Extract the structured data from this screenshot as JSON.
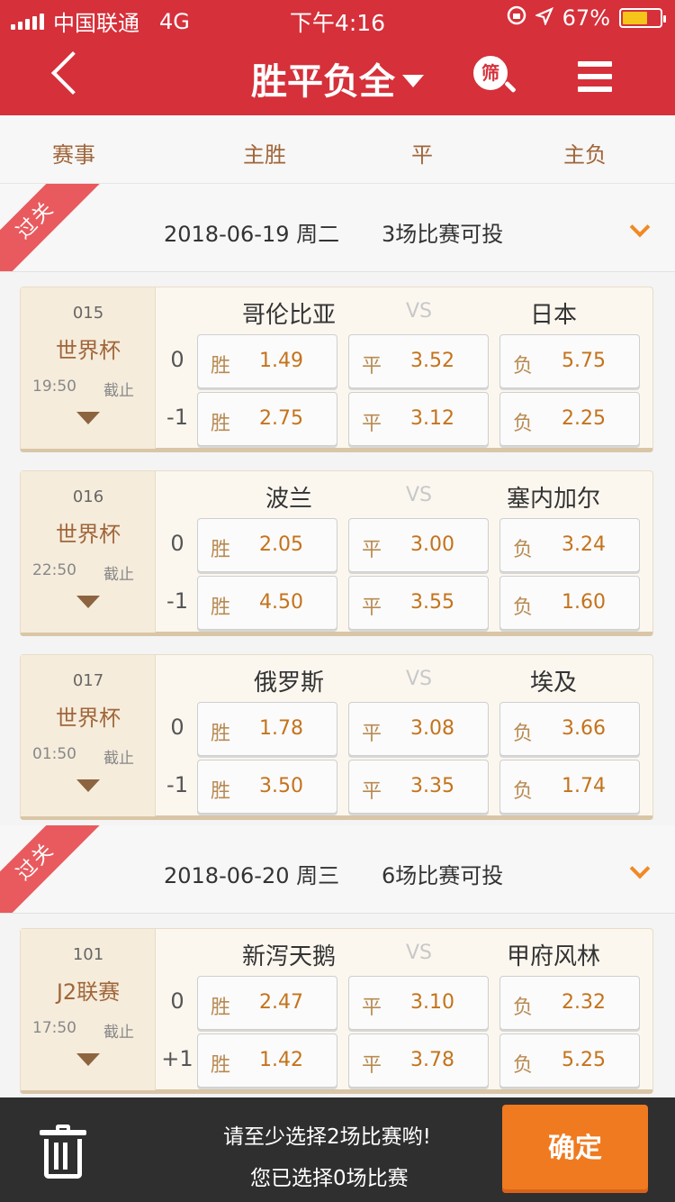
{
  "status_bar": {
    "carrier": "中国联通",
    "network": "4G",
    "time": "下午4:16",
    "battery": "67%",
    "battery_fill": 0.67
  },
  "nav": {
    "title": "胜平负全",
    "filter_label": "筛"
  },
  "columns": [
    "赛事",
    "主胜",
    "平",
    "主负"
  ],
  "ribbon_label": "过关",
  "dates": [
    {
      "date": "2018-06-19 周二",
      "count": "3场比赛可投"
    },
    {
      "date": "2018-06-20 周三",
      "count": "6场比赛可投"
    }
  ],
  "vs_label": "VS",
  "labels": {
    "win": "胜",
    "draw": "平",
    "lose": "负",
    "stop": "截止"
  },
  "matches": [
    {
      "num": "015",
      "league": "世界杯",
      "time": "19:50",
      "home": "哥伦比亚",
      "away": "日本",
      "rows": [
        {
          "handicap": "0",
          "win": "1.49",
          "draw": "3.52",
          "lose": "5.75"
        },
        {
          "handicap": "-1",
          "win": "2.75",
          "draw": "3.12",
          "lose": "2.25"
        }
      ]
    },
    {
      "num": "016",
      "league": "世界杯",
      "time": "22:50",
      "home": "波兰",
      "away": "塞内加尔",
      "rows": [
        {
          "handicap": "0",
          "win": "2.05",
          "draw": "3.00",
          "lose": "3.24"
        },
        {
          "handicap": "-1",
          "win": "4.50",
          "draw": "3.55",
          "lose": "1.60"
        }
      ]
    },
    {
      "num": "017",
      "league": "世界杯",
      "time": "01:50",
      "home": "俄罗斯",
      "away": "埃及",
      "rows": [
        {
          "handicap": "0",
          "win": "1.78",
          "draw": "3.08",
          "lose": "3.66"
        },
        {
          "handicap": "-1",
          "win": "3.50",
          "draw": "3.35",
          "lose": "1.74"
        }
      ]
    },
    {
      "num": "101",
      "league": "J2联赛",
      "time": "17:50",
      "home": "新泻天鹅",
      "away": "甲府风林",
      "rows": [
        {
          "handicap": "0",
          "win": "2.47",
          "draw": "3.10",
          "lose": "2.32"
        },
        {
          "handicap": "+1",
          "win": "1.42",
          "draw": "3.78",
          "lose": "5.25"
        }
      ]
    }
  ],
  "bottom": {
    "hint": "请至少选择2场比赛哟!",
    "selected": "您已选择0场比赛",
    "confirm": "确定"
  },
  "colors": {
    "brand_red": "#d6303a",
    "odds_orange": "#c4731c",
    "confirm_orange": "#f07a1f"
  }
}
